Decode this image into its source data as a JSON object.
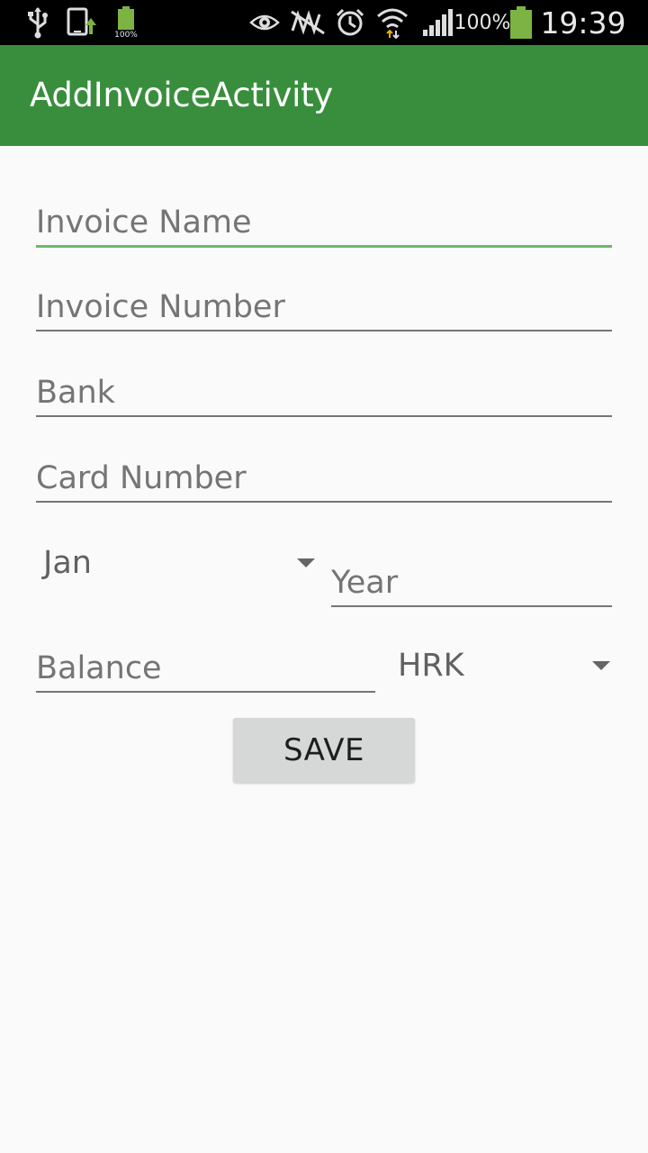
{
  "status_bar": {
    "battery_percent_small": "100%",
    "battery_percent": "100%",
    "time": "19:39",
    "icons": [
      "usb-icon",
      "phone-update-icon",
      "battery-charge-icon",
      "eye-icon",
      "nfc-icon",
      "alarm-icon",
      "wifi-icon",
      "signal-icon",
      "battery-icon"
    ]
  },
  "app_bar": {
    "title": "AddInvoiceActivity"
  },
  "form": {
    "invoice_name_placeholder": "Invoice Name",
    "invoice_number_placeholder": "Invoice Number",
    "bank_placeholder": "Bank",
    "card_number_placeholder": "Card Number",
    "month_selected": "Jan",
    "year_placeholder": "Year",
    "balance_placeholder": "Balance",
    "currency_selected": "HRK",
    "save_label": "SAVE"
  },
  "colors": {
    "app_bar": "#388e3c",
    "focus_underline": "#66bb6a",
    "background": "#fafafa",
    "button": "#d6d7d7"
  }
}
